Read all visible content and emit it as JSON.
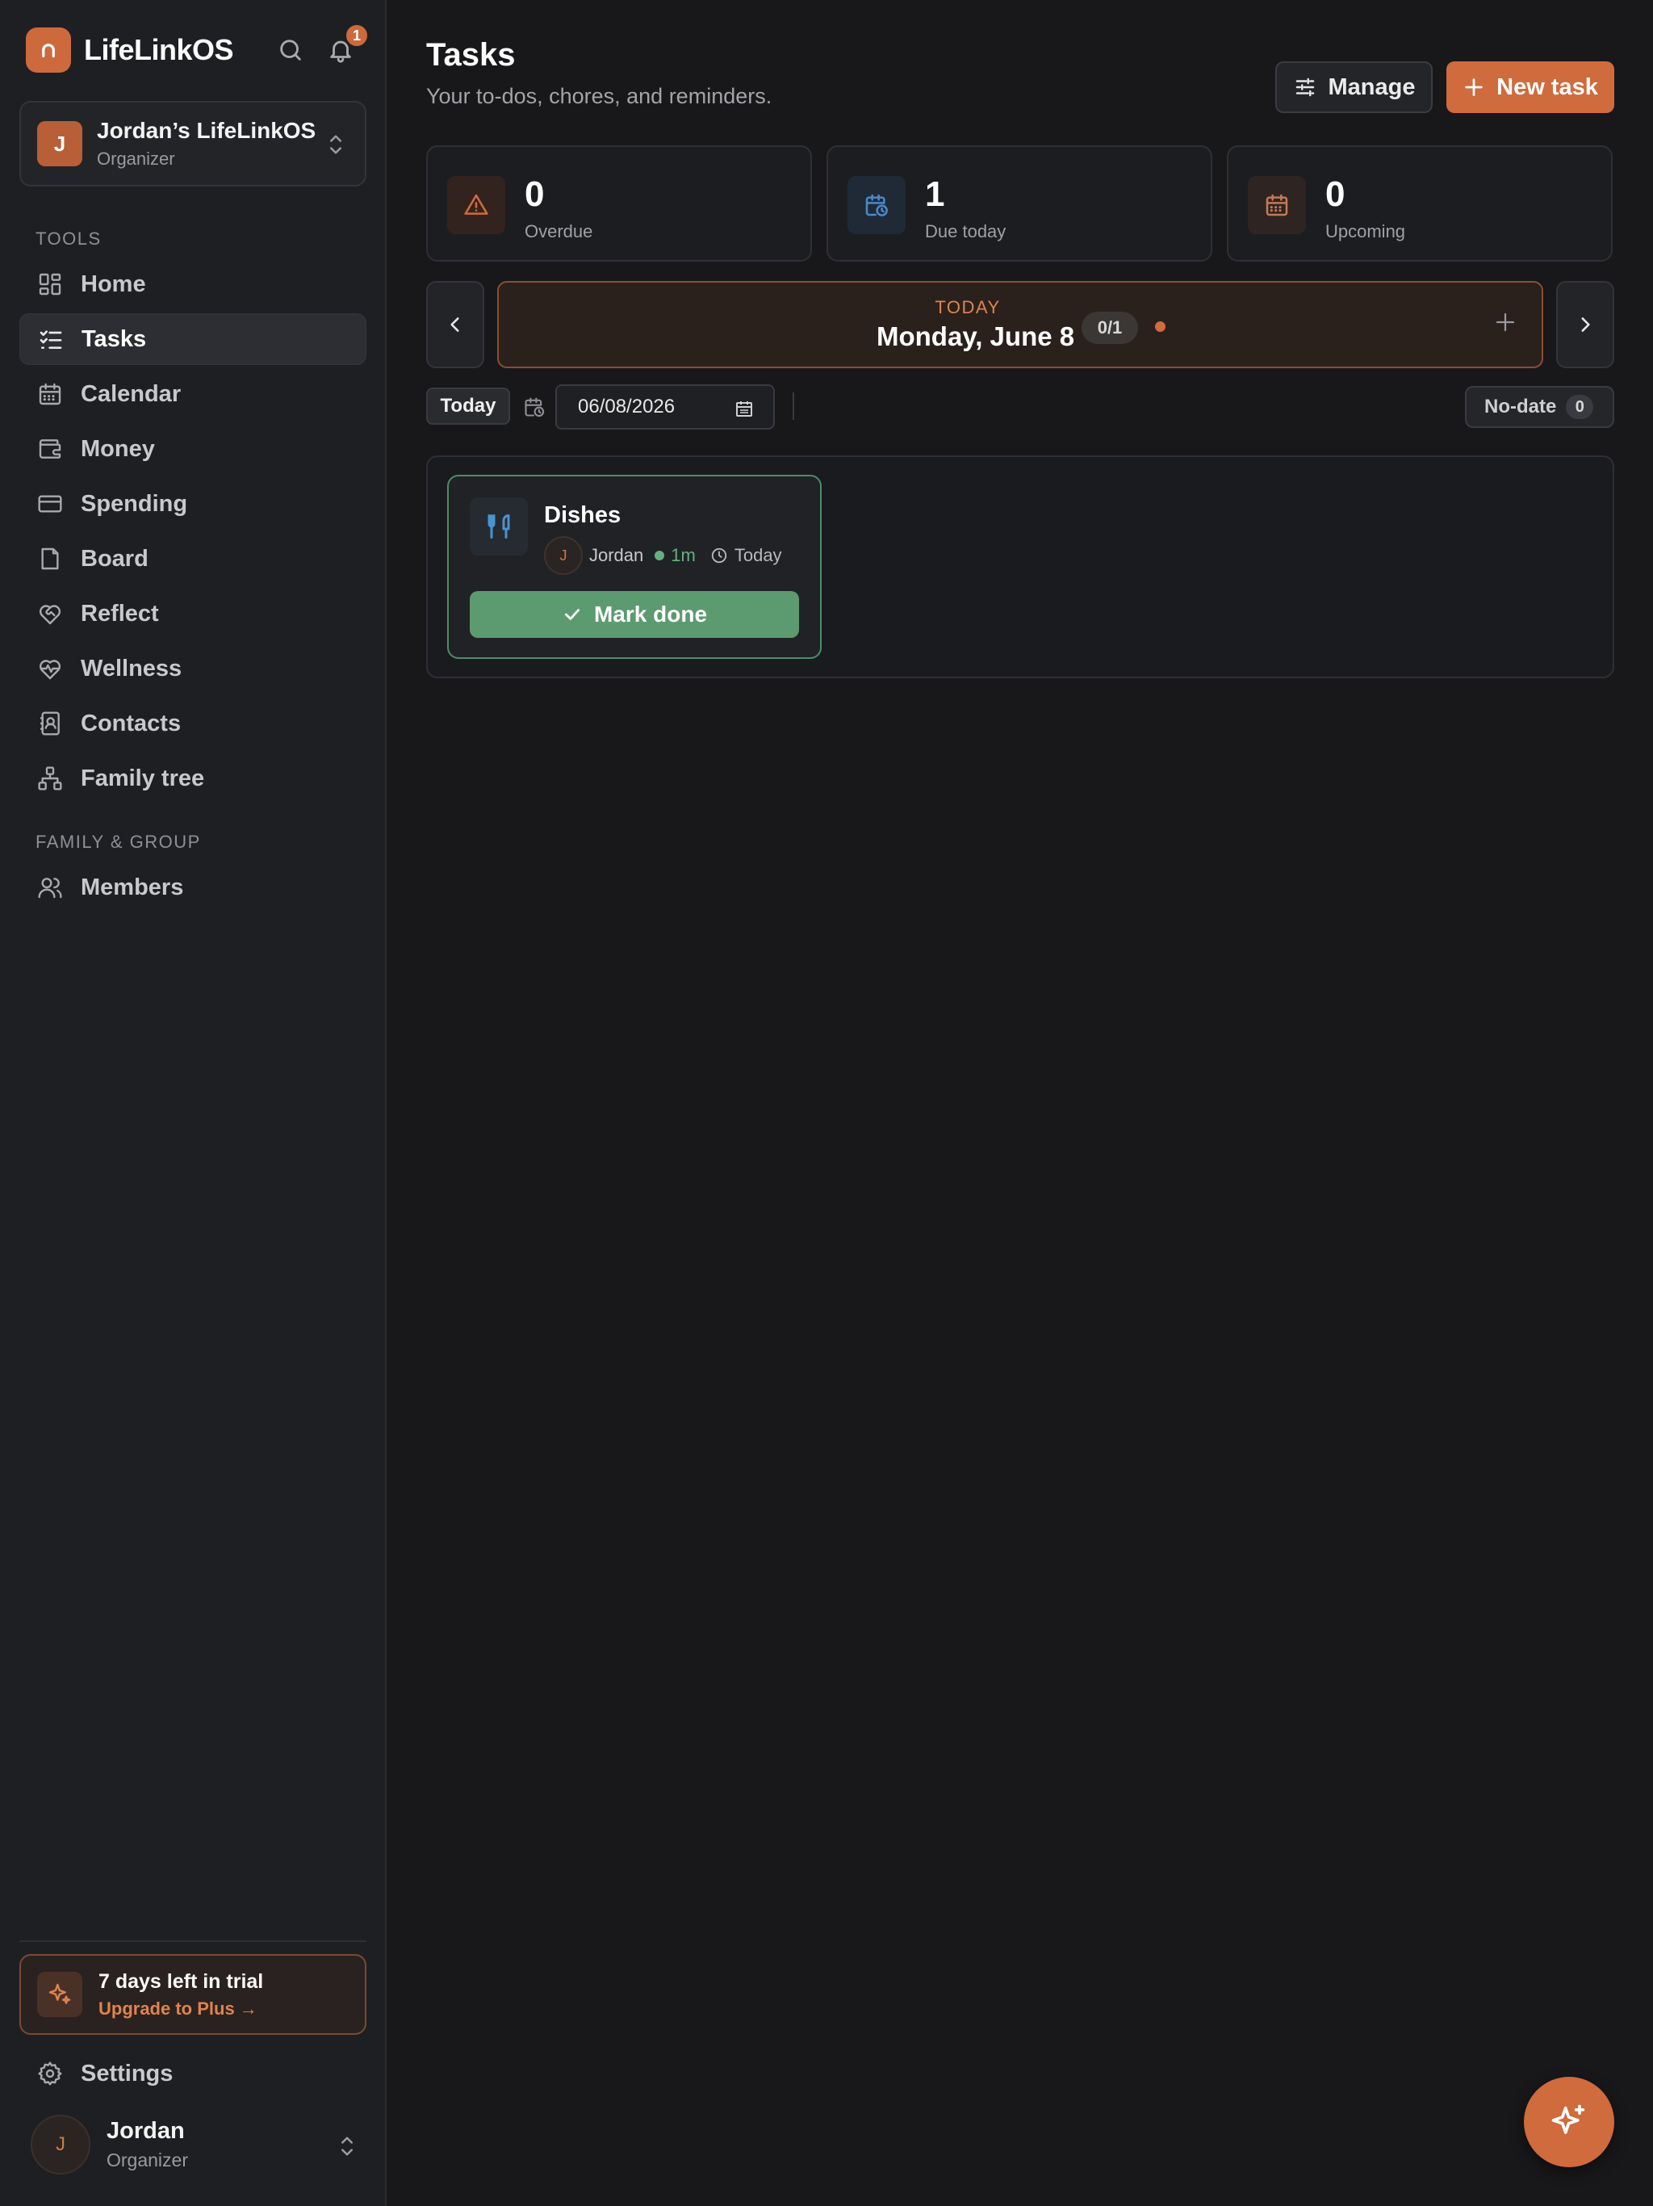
{
  "app": {
    "name": "LifeLinkOS",
    "notification_count": "1"
  },
  "workspace": {
    "initial": "J",
    "name": "Jordan’s LifeLinkOS",
    "role": "Organizer"
  },
  "sidebar": {
    "tools_label": "TOOLS",
    "tools": [
      {
        "label": "Home",
        "icon": "grid-icon"
      },
      {
        "label": "Tasks",
        "icon": "checklist-icon",
        "active": true
      },
      {
        "label": "Calendar",
        "icon": "calendar-icon"
      },
      {
        "label": "Money",
        "icon": "wallet-icon"
      },
      {
        "label": "Spending",
        "icon": "credit-card-icon"
      },
      {
        "label": "Board",
        "icon": "note-icon"
      },
      {
        "label": "Reflect",
        "icon": "heart-handshake-icon"
      },
      {
        "label": "Wellness",
        "icon": "heart-pulse-icon"
      },
      {
        "label": "Contacts",
        "icon": "contact-book-icon"
      },
      {
        "label": "Family tree",
        "icon": "family-tree-icon"
      }
    ],
    "family_label": "FAMILY & GROUP",
    "family": [
      {
        "label": "Members",
        "icon": "users-icon"
      }
    ],
    "trial": {
      "title": "7 days left in trial",
      "link": "Upgrade to Plus →"
    },
    "settings_label": "Settings",
    "user": {
      "initial": "J",
      "name": "Jordan",
      "role": "Organizer"
    }
  },
  "header": {
    "title": "Tasks",
    "subtitle": "Your to-dos, chores, and reminders.",
    "manage_label": "Manage",
    "new_task_label": "New task"
  },
  "stats": [
    {
      "value": "0",
      "label": "Overdue",
      "icon": "alert-triangle-icon"
    },
    {
      "value": "1",
      "label": "Due today",
      "icon": "calendar-clock-icon"
    },
    {
      "value": "0",
      "label": "Upcoming",
      "icon": "calendar-icon"
    }
  ],
  "day": {
    "tag": "TODAY",
    "date": "Monday, June 8",
    "progress": "0/1"
  },
  "filters": {
    "today_label": "Today",
    "date_value": "06/08/2026",
    "no_date_label": "No-date",
    "no_date_count": "0"
  },
  "tasks": [
    {
      "title": "Dishes",
      "icon": "utensils-icon",
      "assignee_initial": "J",
      "assignee": "Jordan",
      "duration": "1m",
      "due": "Today",
      "action": "Mark done"
    }
  ],
  "colors": {
    "accent": "#cf6b3c",
    "success": "#5c9a70",
    "background": "#18181a",
    "sidebar": "#1e1f22"
  }
}
